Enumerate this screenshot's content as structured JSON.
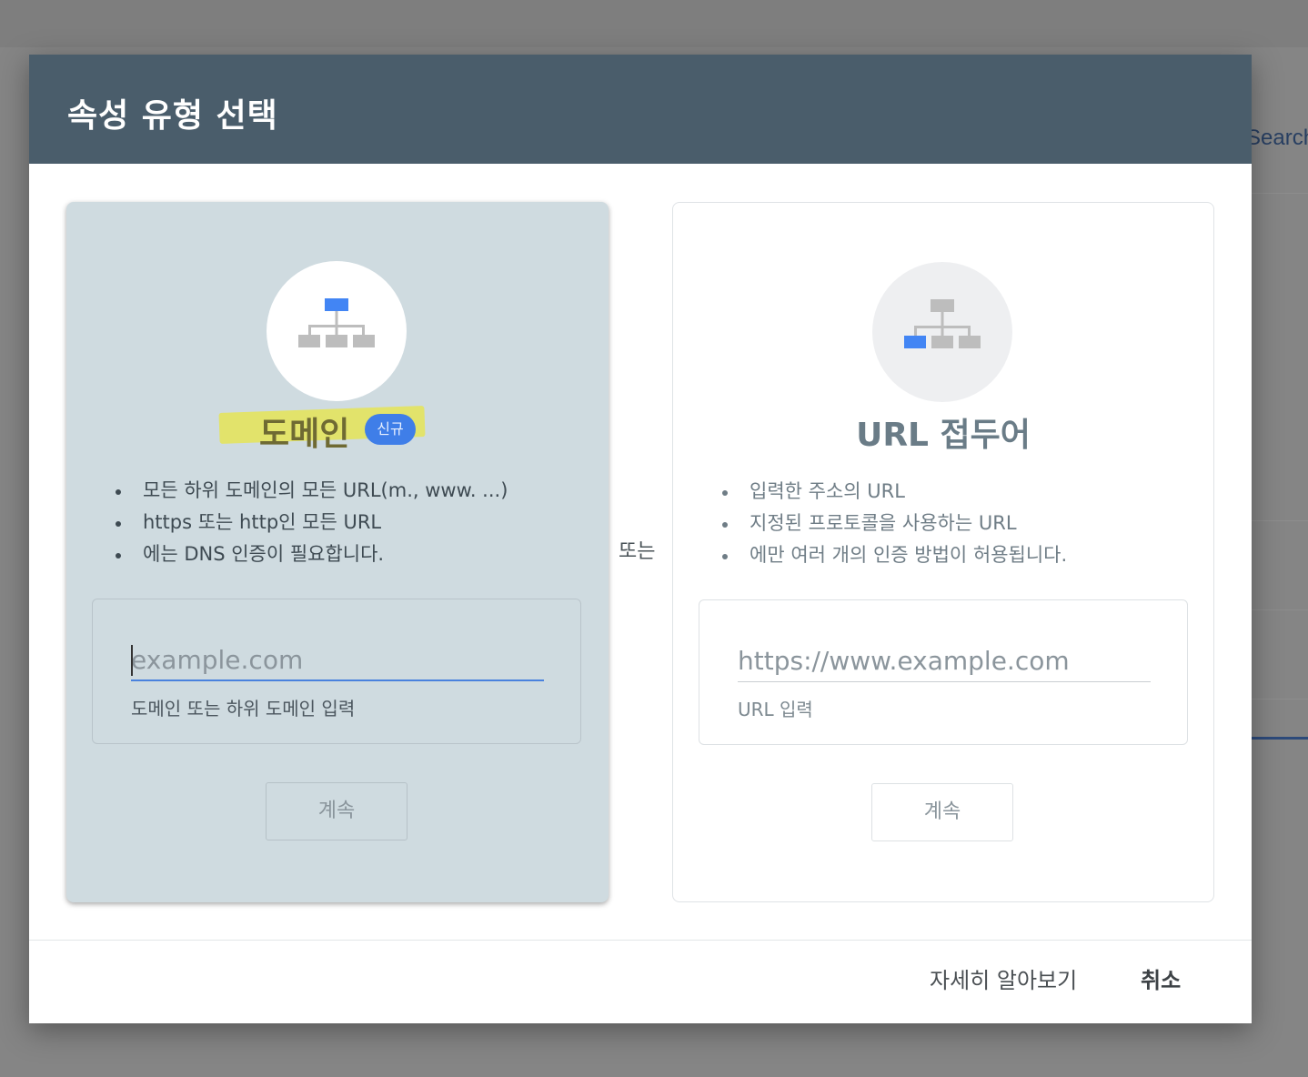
{
  "background": {
    "search_partial": "Search"
  },
  "dialog": {
    "title": "속성 유형 선택",
    "or_label": "또는",
    "domain_card": {
      "title": "도메인",
      "badge": "신규",
      "bullets": [
        "모든 하위 도메인의 모든 URL(m., www. ...)",
        "https 또는 http인 모든 URL",
        "에는 DNS 인증이 필요합니다."
      ],
      "input_placeholder": "example.com",
      "input_value": "",
      "input_hint": "도메인 또는 하위 도메인 입력",
      "continue_label": "계속"
    },
    "url_card": {
      "title": "URL 접두어",
      "bullets": [
        "입력한 주소의 URL",
        "지정된 프로토콜을 사용하는 URL",
        "에만 여러 개의 인증 방법이 허용됩니다."
      ],
      "input_placeholder": "https://www.example.com",
      "input_value": "",
      "input_hint": "URL 입력",
      "continue_label": "계속"
    },
    "footer": {
      "learn_more_label": "자세히 알아보기",
      "cancel_label": "취소"
    }
  },
  "colors": {
    "header_bg": "#4a5d6b",
    "domain_card_bg": "#cfdbe0",
    "accent_blue": "#4285f4",
    "highlight_yellow": "#e2e36b"
  },
  "icons": {
    "domain": "sitemap-icon",
    "url_prefix": "sitemap-icon"
  }
}
